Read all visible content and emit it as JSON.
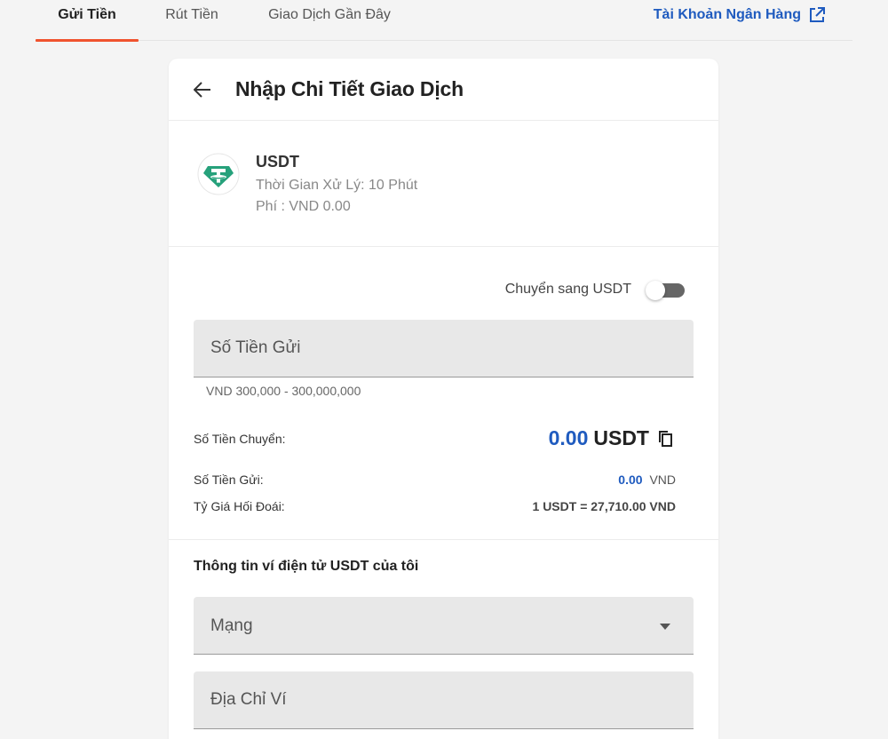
{
  "tabs": [
    {
      "label": "Gửi Tiền",
      "active": true
    },
    {
      "label": "Rút Tiền",
      "active": false
    },
    {
      "label": "Giao Dịch Gần Đây",
      "active": false
    }
  ],
  "bank_link": {
    "label": "Tài Khoản Ngân Hàng",
    "icon": "external-link-icon"
  },
  "card": {
    "title": "Nhập Chi Tiết Giao Dịch",
    "back_icon": "arrow-left-icon"
  },
  "coin": {
    "name": "USDT",
    "processing_time": "Thời Gian Xử Lý: 10 Phút",
    "fee": "Phí : VND 0.00",
    "logo_icon": "tether-logo-icon",
    "logo_color": "#26a17b"
  },
  "form": {
    "toggle_label": "Chuyển sang USDT",
    "toggle_on": false,
    "amount_placeholder": "Số Tiền Gửi",
    "amount_helper": "VND 300,000 - 300,000,000",
    "transfer_label": "Số Tiền Chuyển:",
    "transfer_value": "0.00",
    "transfer_unit": "USDT",
    "copy_icon": "copy-icon",
    "deposit_label": "Số Tiền Gửi:",
    "deposit_value": "0.00",
    "deposit_unit": "VND",
    "rate_label": "Tỷ Giá Hối Đoái:",
    "rate_value": "1 USDT = 27,710.00 VND"
  },
  "wallet": {
    "title": "Thông tin ví điện tử USDT của tôi",
    "network_placeholder": "Mạng",
    "address_placeholder": "Địa Chỉ Ví"
  },
  "colors": {
    "accent": "#f0532e",
    "link": "#1f5bbf",
    "tether": "#26a17b"
  }
}
